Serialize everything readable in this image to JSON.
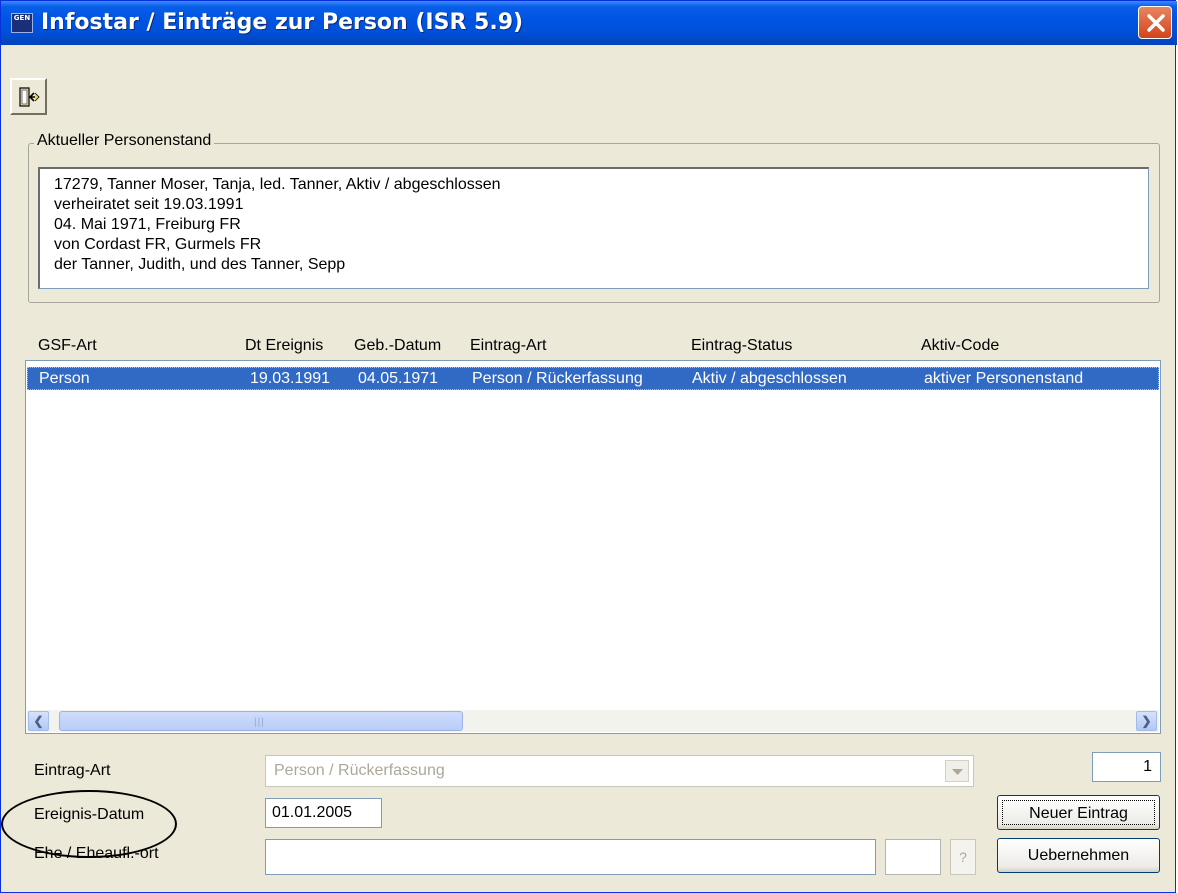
{
  "window": {
    "title": "Infostar / Einträge zur Person (ISR 5.9)",
    "app_icon_text": "GEN"
  },
  "status_group": {
    "label": "Aktueller Personenstand",
    "lines": [
      "17279, Tanner Moser, Tanja, led. Tanner, Aktiv / abgeschlossen",
      "verheiratet seit 19.03.1991",
      "04. Mai 1971, Freiburg FR",
      "von Cordast FR, Gurmels FR",
      "der Tanner, Judith, und des Tanner, Sepp"
    ]
  },
  "table": {
    "columns": [
      "GSF-Art",
      "Dt Ereignis",
      "Geb.-Datum",
      "Eintrag-Art",
      "Eintrag-Status",
      "Aktiv-Code"
    ],
    "rows": [
      [
        "Person",
        "19.03.1991",
        "04.05.1971",
        "Person / Rückerfassung",
        "Aktiv / abgeschlossen",
        "aktiver Personenstand"
      ]
    ],
    "selected_row": 0
  },
  "form": {
    "eintrag_art_label": "Eintrag-Art",
    "eintrag_art_value": "Person / Rückerfassung",
    "count_value": "1",
    "ereignis_datum_label": "Ereignis-Datum",
    "ereignis_datum_value": "01.01.2005",
    "ort_label": "Ehe / Eheaufl.-ort",
    "ort_value": "",
    "code_value": "",
    "help_label": "?",
    "new_entry_label": "Neuer Eintrag",
    "apply_label": "Uebernehmen"
  },
  "icons": {
    "exit": "exit-door-icon",
    "close": "close-icon"
  },
  "colors": {
    "title_bar": "#0054E3",
    "selection": "#316AC5",
    "close_button": "#D4421B",
    "window_bg": "#ECE9D8"
  }
}
